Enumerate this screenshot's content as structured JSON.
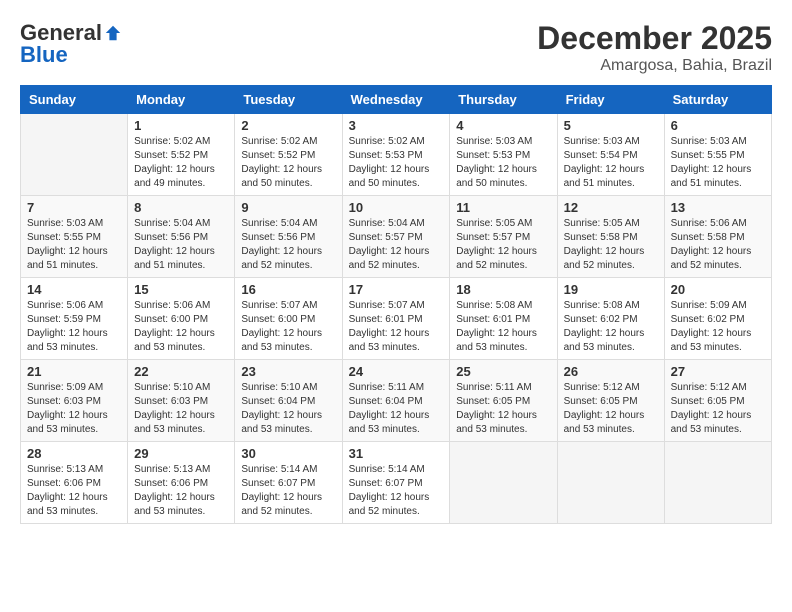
{
  "logo": {
    "general": "General",
    "blue": "Blue"
  },
  "title": "December 2025",
  "location": "Amargosa, Bahia, Brazil",
  "days": [
    "Sunday",
    "Monday",
    "Tuesday",
    "Wednesday",
    "Thursday",
    "Friday",
    "Saturday"
  ],
  "weeks": [
    [
      {
        "day": "",
        "sunrise": "",
        "sunset": "",
        "daylight": ""
      },
      {
        "day": "1",
        "sunrise": "Sunrise: 5:02 AM",
        "sunset": "Sunset: 5:52 PM",
        "daylight": "Daylight: 12 hours and 49 minutes."
      },
      {
        "day": "2",
        "sunrise": "Sunrise: 5:02 AM",
        "sunset": "Sunset: 5:52 PM",
        "daylight": "Daylight: 12 hours and 50 minutes."
      },
      {
        "day": "3",
        "sunrise": "Sunrise: 5:02 AM",
        "sunset": "Sunset: 5:53 PM",
        "daylight": "Daylight: 12 hours and 50 minutes."
      },
      {
        "day": "4",
        "sunrise": "Sunrise: 5:03 AM",
        "sunset": "Sunset: 5:53 PM",
        "daylight": "Daylight: 12 hours and 50 minutes."
      },
      {
        "day": "5",
        "sunrise": "Sunrise: 5:03 AM",
        "sunset": "Sunset: 5:54 PM",
        "daylight": "Daylight: 12 hours and 51 minutes."
      },
      {
        "day": "6",
        "sunrise": "Sunrise: 5:03 AM",
        "sunset": "Sunset: 5:55 PM",
        "daylight": "Daylight: 12 hours and 51 minutes."
      }
    ],
    [
      {
        "day": "7",
        "sunrise": "Sunrise: 5:03 AM",
        "sunset": "Sunset: 5:55 PM",
        "daylight": "Daylight: 12 hours and 51 minutes."
      },
      {
        "day": "8",
        "sunrise": "Sunrise: 5:04 AM",
        "sunset": "Sunset: 5:56 PM",
        "daylight": "Daylight: 12 hours and 51 minutes."
      },
      {
        "day": "9",
        "sunrise": "Sunrise: 5:04 AM",
        "sunset": "Sunset: 5:56 PM",
        "daylight": "Daylight: 12 hours and 52 minutes."
      },
      {
        "day": "10",
        "sunrise": "Sunrise: 5:04 AM",
        "sunset": "Sunset: 5:57 PM",
        "daylight": "Daylight: 12 hours and 52 minutes."
      },
      {
        "day": "11",
        "sunrise": "Sunrise: 5:05 AM",
        "sunset": "Sunset: 5:57 PM",
        "daylight": "Daylight: 12 hours and 52 minutes."
      },
      {
        "day": "12",
        "sunrise": "Sunrise: 5:05 AM",
        "sunset": "Sunset: 5:58 PM",
        "daylight": "Daylight: 12 hours and 52 minutes."
      },
      {
        "day": "13",
        "sunrise": "Sunrise: 5:06 AM",
        "sunset": "Sunset: 5:58 PM",
        "daylight": "Daylight: 12 hours and 52 minutes."
      }
    ],
    [
      {
        "day": "14",
        "sunrise": "Sunrise: 5:06 AM",
        "sunset": "Sunset: 5:59 PM",
        "daylight": "Daylight: 12 hours and 53 minutes."
      },
      {
        "day": "15",
        "sunrise": "Sunrise: 5:06 AM",
        "sunset": "Sunset: 6:00 PM",
        "daylight": "Daylight: 12 hours and 53 minutes."
      },
      {
        "day": "16",
        "sunrise": "Sunrise: 5:07 AM",
        "sunset": "Sunset: 6:00 PM",
        "daylight": "Daylight: 12 hours and 53 minutes."
      },
      {
        "day": "17",
        "sunrise": "Sunrise: 5:07 AM",
        "sunset": "Sunset: 6:01 PM",
        "daylight": "Daylight: 12 hours and 53 minutes."
      },
      {
        "day": "18",
        "sunrise": "Sunrise: 5:08 AM",
        "sunset": "Sunset: 6:01 PM",
        "daylight": "Daylight: 12 hours and 53 minutes."
      },
      {
        "day": "19",
        "sunrise": "Sunrise: 5:08 AM",
        "sunset": "Sunset: 6:02 PM",
        "daylight": "Daylight: 12 hours and 53 minutes."
      },
      {
        "day": "20",
        "sunrise": "Sunrise: 5:09 AM",
        "sunset": "Sunset: 6:02 PM",
        "daylight": "Daylight: 12 hours and 53 minutes."
      }
    ],
    [
      {
        "day": "21",
        "sunrise": "Sunrise: 5:09 AM",
        "sunset": "Sunset: 6:03 PM",
        "daylight": "Daylight: 12 hours and 53 minutes."
      },
      {
        "day": "22",
        "sunrise": "Sunrise: 5:10 AM",
        "sunset": "Sunset: 6:03 PM",
        "daylight": "Daylight: 12 hours and 53 minutes."
      },
      {
        "day": "23",
        "sunrise": "Sunrise: 5:10 AM",
        "sunset": "Sunset: 6:04 PM",
        "daylight": "Daylight: 12 hours and 53 minutes."
      },
      {
        "day": "24",
        "sunrise": "Sunrise: 5:11 AM",
        "sunset": "Sunset: 6:04 PM",
        "daylight": "Daylight: 12 hours and 53 minutes."
      },
      {
        "day": "25",
        "sunrise": "Sunrise: 5:11 AM",
        "sunset": "Sunset: 6:05 PM",
        "daylight": "Daylight: 12 hours and 53 minutes."
      },
      {
        "day": "26",
        "sunrise": "Sunrise: 5:12 AM",
        "sunset": "Sunset: 6:05 PM",
        "daylight": "Daylight: 12 hours and 53 minutes."
      },
      {
        "day": "27",
        "sunrise": "Sunrise: 5:12 AM",
        "sunset": "Sunset: 6:05 PM",
        "daylight": "Daylight: 12 hours and 53 minutes."
      }
    ],
    [
      {
        "day": "28",
        "sunrise": "Sunrise: 5:13 AM",
        "sunset": "Sunset: 6:06 PM",
        "daylight": "Daylight: 12 hours and 53 minutes."
      },
      {
        "day": "29",
        "sunrise": "Sunrise: 5:13 AM",
        "sunset": "Sunset: 6:06 PM",
        "daylight": "Daylight: 12 hours and 53 minutes."
      },
      {
        "day": "30",
        "sunrise": "Sunrise: 5:14 AM",
        "sunset": "Sunset: 6:07 PM",
        "daylight": "Daylight: 12 hours and 52 minutes."
      },
      {
        "day": "31",
        "sunrise": "Sunrise: 5:14 AM",
        "sunset": "Sunset: 6:07 PM",
        "daylight": "Daylight: 12 hours and 52 minutes."
      },
      {
        "day": "",
        "sunrise": "",
        "sunset": "",
        "daylight": ""
      },
      {
        "day": "",
        "sunrise": "",
        "sunset": "",
        "daylight": ""
      },
      {
        "day": "",
        "sunrise": "",
        "sunset": "",
        "daylight": ""
      }
    ]
  ]
}
